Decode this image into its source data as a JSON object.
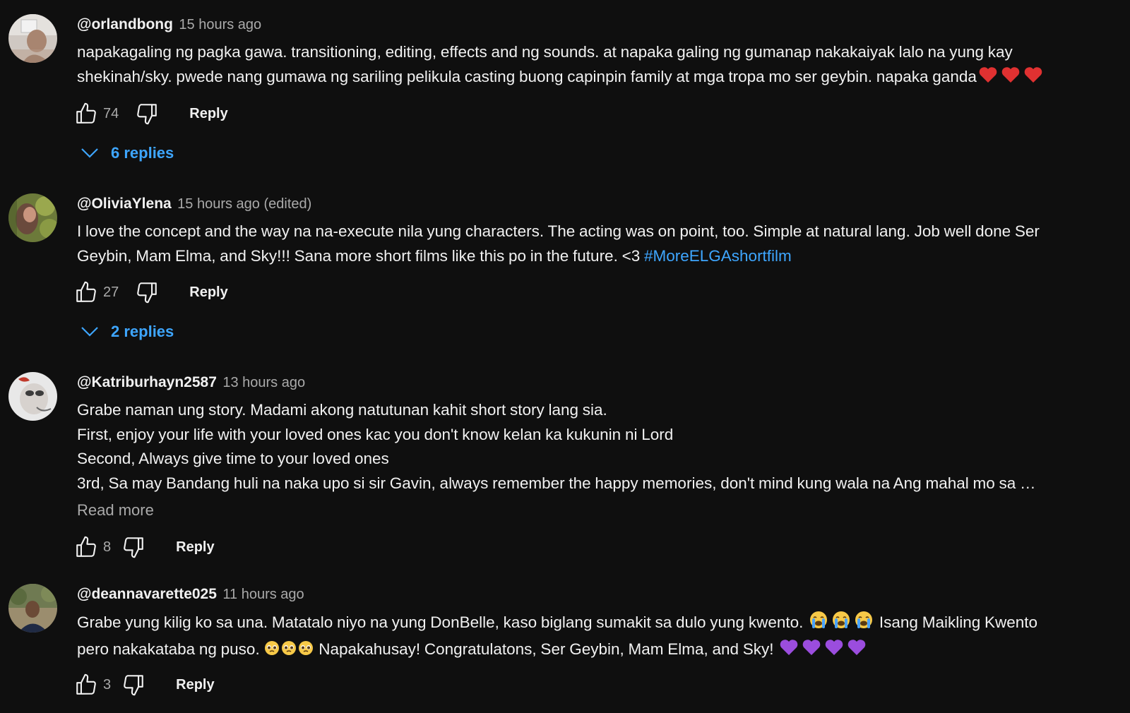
{
  "comments": [
    {
      "author": "@orlandbong",
      "time": "15 hours ago",
      "lines": [
        "napakagaling ng pagka gawa. transitioning, editing, effects and ng sounds. at napaka galing ng gumanap nakakaiyak lalo na yung kay",
        "shekinah/sky. pwede nang gumawa ng sariling pelikula casting buong capinpin family at mga tropa mo ser geybin. napaka ganda"
      ],
      "likes": "74",
      "reply_label": "Reply",
      "replies_label": "6 replies"
    },
    {
      "author": "@OliviaYlena",
      "time": "15 hours ago (edited)",
      "lines": [
        "I love the concept and the way na na-execute nila yung characters. The acting was on point, too. Simple at natural lang. Job well done Ser",
        "Geybin, Mam Elma, and Sky!!! Sana more short films like this po in the future. <3 "
      ],
      "hashtag": "#MoreELGAshortfilm",
      "likes": "27",
      "reply_label": "Reply",
      "replies_label": "2 replies"
    },
    {
      "author": "@Katriburhayn2587",
      "time": "13 hours ago",
      "lines": [
        "Grabe naman ung story. Madami akong natutunan kahit short story lang sia.",
        "First, enjoy your life with your loved ones kac you don't know kelan ka kukunin ni Lord",
        "Second, Always give time to your loved ones",
        "3rd, Sa may Bandang huli na naka upo si sir Gavin, always remember the happy memories, don't mind kung wala na Ang mahal mo sa …"
      ],
      "read_more": "Read more",
      "likes": "8",
      "reply_label": "Reply"
    },
    {
      "author": "@deannavarette025",
      "time": "11 hours ago",
      "lines": [
        "Grabe yung kilig ko sa una. Matatalo niyo na yung DonBelle, kaso biglang sumakit sa dulo yung kwento.",
        "Isang Maikling Kwento",
        "pero nakakataba ng puso.",
        "Napakahusay! Congratulatons, Ser Geybin, Mam Elma, and Sky!"
      ],
      "likes": "3",
      "reply_label": "Reply"
    }
  ],
  "emoji_names": {
    "heart": "red-heart-emoji",
    "crying": "loudly-crying-face-emoji",
    "pleading": "pleading-face-emoji",
    "purple_heart": "purple-heart-emoji"
  },
  "colors": {
    "background": "#0f0f0f",
    "text": "#f1f1f1",
    "muted": "#aaaaaa",
    "link": "#3ea6ff"
  }
}
